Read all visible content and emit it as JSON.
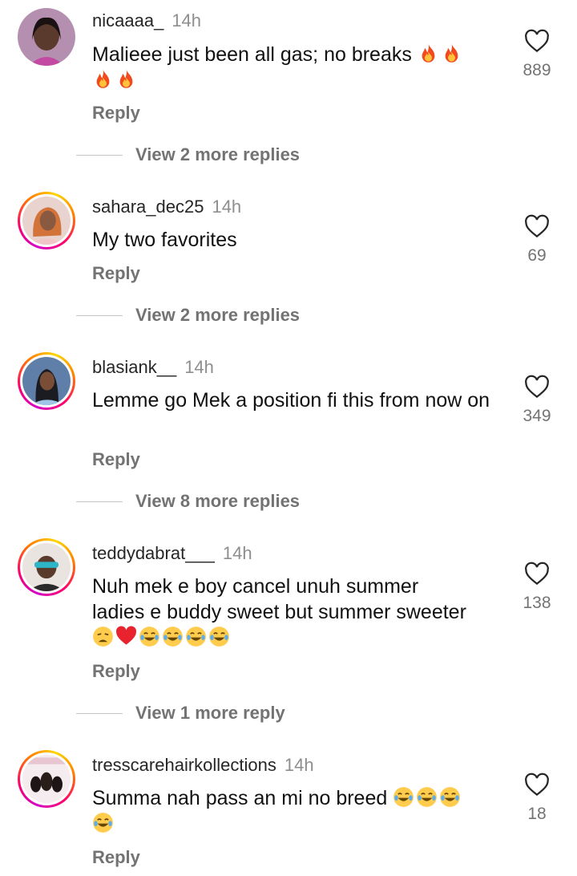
{
  "comments": [
    {
      "username": "nicaaaa_",
      "time": "14h",
      "text": "Malieee just been all gas; no breaks 🔥🔥🔥🔥",
      "likes": "889",
      "reply_label": "Reply",
      "more_replies": "View 2 more replies",
      "avatar_ring": false
    },
    {
      "username": "sahara_dec25",
      "time": "14h",
      "text": "My two favorites",
      "likes": "69",
      "reply_label": "Reply",
      "more_replies": "View 2 more replies",
      "avatar_ring": true
    },
    {
      "username": "blasiank__",
      "time": "14h",
      "text": "Lemme go Mek a position fi this from now on",
      "likes": "349",
      "reply_label": "Reply",
      "more_replies": "View 8 more replies",
      "avatar_ring": true
    },
    {
      "username": "teddydabrat___",
      "time": "14h",
      "text": "Nuh mek e boy cancel unuh summer ladies e buddy sweet but summer sweeter 😩❤️😂😂😂😂",
      "likes": "138",
      "reply_label": "Reply",
      "more_replies": "View 1 more reply",
      "avatar_ring": true
    },
    {
      "username": "tresscarehairkollections",
      "time": "14h",
      "text": "Summa nah pass an mi no breed 😂😂😂😂",
      "likes": "18",
      "reply_label": "Reply",
      "avatar_ring": true
    }
  ],
  "colors": {
    "text": "#111111",
    "secondary": "#737373",
    "timestamp": "#8e8e8e",
    "ring_start": "#d300c5",
    "ring_end": "#ffd600"
  },
  "icons": {
    "like": "heart-outline-icon"
  }
}
